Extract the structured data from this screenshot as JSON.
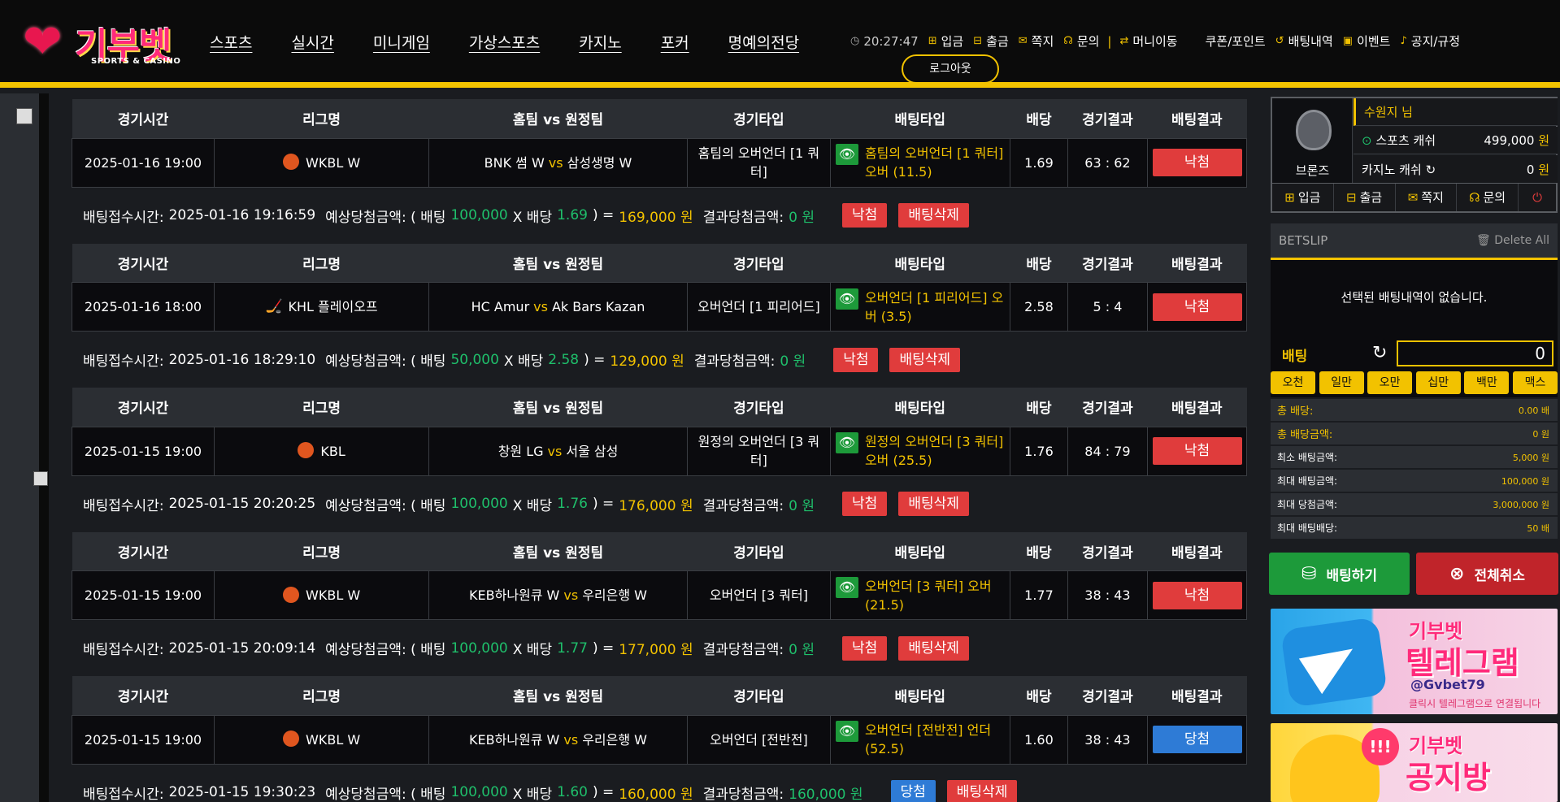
{
  "header": {
    "brand": "기부벳",
    "brand_sub": "SPORTS & CASINO",
    "nav": [
      "스포츠",
      "실시간",
      "미니게임",
      "가상스포츠",
      "카지노",
      "포커",
      "명예의전당"
    ],
    "clock": "20:27:47",
    "top_links": {
      "deposit": "입금",
      "withdraw": "출금",
      "message": "쪽지",
      "inquiry": "문의",
      "money_move": "머니이동",
      "coupon": "쿠폰/포인트",
      "bet_history": "배팅내역",
      "event": "이벤트",
      "notice": "공지/규정"
    },
    "logout": "로그아웃"
  },
  "table_headers": [
    "경기시간",
    "리그명",
    "홈팀 vs 원정팀",
    "경기타입",
    "배팅타입",
    "배당",
    "경기결과",
    "배팅결과"
  ],
  "vs_label": "vs",
  "bets": [
    {
      "time": "2025-01-16 19:00",
      "league": "WKBL W",
      "home": "BNK 썸 W",
      "away": "삼성생명 W",
      "game_type": "홈팀의 오버언더 [1 쿼터]",
      "bet_type": "홈팀의 오버언더 [1 쿼터] 오버 (11.5)",
      "odds": "1.69",
      "score": "63 : 62",
      "result": "낙첨",
      "summary": {
        "label": "배팅접수시간:",
        "received": "2025-01-16 19:16:59",
        "expected_label": "예상당첨금액: ( 배팅",
        "stake": "100,000",
        "x": "X 배당",
        "odds": "1.69",
        "eq": ") =",
        "expected": "169,000 원",
        "result_label": "결과당첨금액:",
        "result_amount": "0 원",
        "status": "낙첨",
        "delete": "배팅삭제"
      }
    },
    {
      "time": "2025-01-16 18:00",
      "league": "KHL 플레이오프",
      "home": "HC Amur",
      "away": "Ak Bars Kazan",
      "game_type": "오버언더 [1 피리어드]",
      "bet_type": "오버언더 [1 피리어드] 오버 (3.5)",
      "odds": "2.58",
      "score": "5 : 4",
      "result": "낙첨",
      "summary": {
        "label": "배팅접수시간:",
        "received": "2025-01-16 18:29:10",
        "expected_label": "예상당첨금액: ( 배팅",
        "stake": "50,000",
        "x": "X 배당",
        "odds": "2.58",
        "eq": ") =",
        "expected": "129,000 원",
        "result_label": "결과당첨금액:",
        "result_amount": "0 원",
        "status": "낙첨",
        "delete": "배팅삭제"
      }
    },
    {
      "time": "2025-01-15 19:00",
      "league": "KBL",
      "home": "창원 LG",
      "away": "서울 삼성",
      "game_type": "원정의 오버언더 [3 쿼터]",
      "bet_type": "원정의 오버언더 [3 쿼터] 오버 (25.5)",
      "odds": "1.76",
      "score": "84 : 79",
      "result": "낙첨",
      "summary": {
        "label": "배팅접수시간:",
        "received": "2025-01-15 20:20:25",
        "expected_label": "예상당첨금액: ( 배팅",
        "stake": "100,000",
        "x": "X 배당",
        "odds": "1.76",
        "eq": ") =",
        "expected": "176,000 원",
        "result_label": "결과당첨금액:",
        "result_amount": "0 원",
        "status": "낙첨",
        "delete": "배팅삭제"
      }
    },
    {
      "time": "2025-01-15 19:00",
      "league": "WKBL W",
      "home": "KEB하나원큐 W",
      "away": "우리은행 W",
      "game_type": "오버언더 [3 쿼터]",
      "bet_type": "오버언더 [3 쿼터] 오버 (21.5)",
      "odds": "1.77",
      "score": "38 : 43",
      "result": "낙첨",
      "summary": {
        "label": "배팅접수시간:",
        "received": "2025-01-15 20:09:14",
        "expected_label": "예상당첨금액: ( 배팅",
        "stake": "100,000",
        "x": "X 배당",
        "odds": "1.77",
        "eq": ") =",
        "expected": "177,000 원",
        "result_label": "결과당첨금액:",
        "result_amount": "0 원",
        "status": "낙첨",
        "delete": "배팅삭제"
      }
    },
    {
      "time": "2025-01-15 19:00",
      "league": "WKBL W",
      "home": "KEB하나원큐 W",
      "away": "우리은행 W",
      "game_type": "오버언더 [전반전]",
      "bet_type": "오버언더 [전반전] 언더 (52.5)",
      "odds": "1.60",
      "score": "38 : 43",
      "result": "당첨",
      "summary": {
        "label": "배팅접수시간:",
        "received": "2025-01-15 19:30:23",
        "expected_label": "예상당첨금액: ( 배팅",
        "stake": "100,000",
        "x": "X 배당",
        "odds": "1.60",
        "eq": ") =",
        "expected": "160,000 원",
        "result_label": "결과당첨금액:",
        "result_amount": "160,000 원",
        "status": "당첨",
        "delete": "배팅삭제"
      }
    }
  ],
  "user": {
    "name": "수원지 님",
    "rank": "브론즈",
    "sports_cash_label": "스포츠 캐쉬",
    "sports_cash": "499,000",
    "casino_cash_label": "카지노 캐쉬",
    "casino_cash": "0",
    "won": "원"
  },
  "side_menu": {
    "deposit": "입금",
    "withdraw": "출금",
    "message": "쪽지",
    "inquiry": "문의"
  },
  "betslip": {
    "title": "BETSLIP",
    "delete_all": "Delete All",
    "empty": "선택된 배팅내역이 없습니다.",
    "bet_label": "배팅",
    "amount": "0",
    "chips": [
      "오천",
      "일만",
      "오만",
      "십만",
      "백만",
      "맥스"
    ],
    "info": [
      {
        "k": "총 배당:",
        "v": "0.00 배",
        "hl": true
      },
      {
        "k": "총 배당금액:",
        "v": "0 원",
        "hl": true
      },
      {
        "k": "최소 배팅금액:",
        "v": "5,000 원",
        "hl": false
      },
      {
        "k": "최대 배팅금액:",
        "v": "100,000 원",
        "hl": false
      },
      {
        "k": "최대 당첨금액:",
        "v": "3,000,000 원",
        "hl": false
      },
      {
        "k": "최대 배팅배당:",
        "v": "50 배",
        "hl": false
      }
    ],
    "place_bet": "배팅하기",
    "cancel_all": "전체취소"
  },
  "banners": {
    "telegram": {
      "brand": "기부벳",
      "title": "텔레그램",
      "handle": "@Gvbet79",
      "caption": "클릭시 텔레그램으로 연결됩니다"
    },
    "notice_room": {
      "brand": "기부벳",
      "title": "공지방",
      "badge": "!!!"
    }
  },
  "colors": {
    "accent": "#f2c200",
    "win": "#2e7bd6",
    "lose": "#e03c3c",
    "green": "#1fbf6b"
  }
}
